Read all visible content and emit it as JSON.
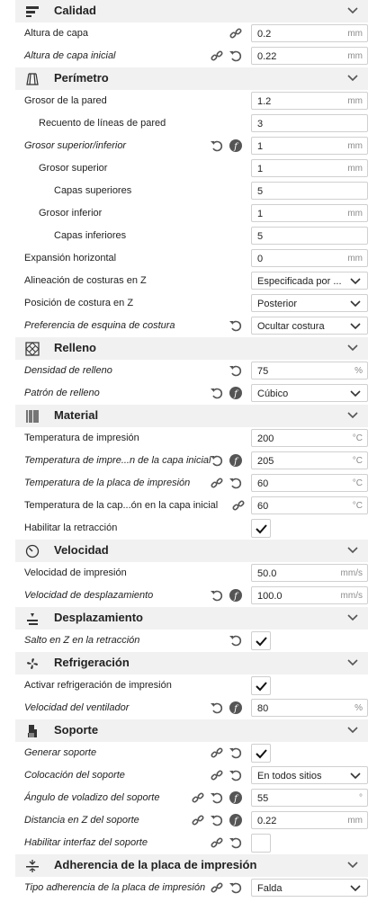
{
  "sections": {
    "quality": "Calidad",
    "walls": "Perímetro",
    "infill": "Relleno",
    "material": "Material",
    "speed": "Velocidad",
    "travel": "Desplazamiento",
    "cooling": "Refrigeración",
    "support": "Soporte",
    "adhesion": "Adherencia de la placa de impresión"
  },
  "quality": {
    "layer_height": {
      "label": "Altura de capa",
      "value": "0.2",
      "unit": "mm"
    },
    "initial_layer_height": {
      "label": "Altura de capa inicial",
      "value": "0.22",
      "unit": "mm"
    }
  },
  "walls": {
    "wall_thickness": {
      "label": "Grosor de la pared",
      "value": "1.2",
      "unit": "mm"
    },
    "wall_line_count": {
      "label": "Recuento de líneas de pared",
      "value": "3"
    },
    "top_bottom_thickness": {
      "label": "Grosor superior/inferior",
      "value": "1",
      "unit": "mm"
    },
    "top_thickness": {
      "label": "Grosor superior",
      "value": "1",
      "unit": "mm"
    },
    "top_layers": {
      "label": "Capas superiores",
      "value": "5"
    },
    "bottom_thickness": {
      "label": "Grosor inferior",
      "value": "1",
      "unit": "mm"
    },
    "bottom_layers": {
      "label": "Capas inferiores",
      "value": "5"
    },
    "horizontal_expansion": {
      "label": "Expansión horizontal",
      "value": "0",
      "unit": "mm"
    },
    "z_seam_alignment": {
      "label": "Alineación de costuras en Z",
      "value": "Especificada por ..."
    },
    "z_seam_position": {
      "label": "Posición de costura en Z",
      "value": "Posterior"
    },
    "seam_corner_preference": {
      "label": "Preferencia de esquina de costura",
      "value": "Ocultar costura"
    }
  },
  "infill": {
    "infill_density": {
      "label": "Densidad de relleno",
      "value": "75",
      "unit": "%"
    },
    "infill_pattern": {
      "label": "Patrón de relleno",
      "value": "Cúbico"
    }
  },
  "material": {
    "print_temp": {
      "label": "Temperatura de impresión",
      "value": "200",
      "unit": "°C"
    },
    "print_temp_initial": {
      "label": "Temperatura de impre...n de la capa inicial",
      "value": "205",
      "unit": "°C"
    },
    "bed_temp": {
      "label": "Temperatura de la placa de impresión",
      "value": "60",
      "unit": "°C"
    },
    "bed_temp_initial": {
      "label": "Temperatura de la cap...ón en la capa inicial",
      "value": "60",
      "unit": "°C"
    },
    "retraction": {
      "label": "Habilitar la retracción",
      "checked": true
    }
  },
  "speed": {
    "print_speed": {
      "label": "Velocidad de impresión",
      "value": "50.0",
      "unit": "mm/s"
    },
    "travel_speed": {
      "label": "Velocidad de desplazamiento",
      "value": "100.0",
      "unit": "mm/s"
    }
  },
  "travel": {
    "z_hop": {
      "label": "Salto en Z en la retracción",
      "checked": true
    }
  },
  "cooling": {
    "enable_cooling": {
      "label": "Activar refrigeración de impresión",
      "checked": true
    },
    "fan_speed": {
      "label": "Velocidad del ventilador",
      "value": "80",
      "unit": "%"
    }
  },
  "support": {
    "generate": {
      "label": "Generar soporte",
      "checked": true
    },
    "placement": {
      "label": "Colocación del soporte",
      "value": "En todos sitios"
    },
    "overhang_angle": {
      "label": "Ángulo de voladizo del soporte",
      "value": "55",
      "unit": "°"
    },
    "z_distance": {
      "label": "Distancia en Z del soporte",
      "value": "0.22",
      "unit": "mm"
    },
    "interface": {
      "label": "Habilitar interfaz del soporte",
      "checked": false
    }
  },
  "adhesion": {
    "type": {
      "label": "Tipo adherencia de la placa de impresión",
      "value": "Falda"
    }
  },
  "colors": {
    "header_bg": "#f1f1f1",
    "field_border": "#d0d0d0",
    "icon": "#555555",
    "unit": "#8c8c8c"
  }
}
